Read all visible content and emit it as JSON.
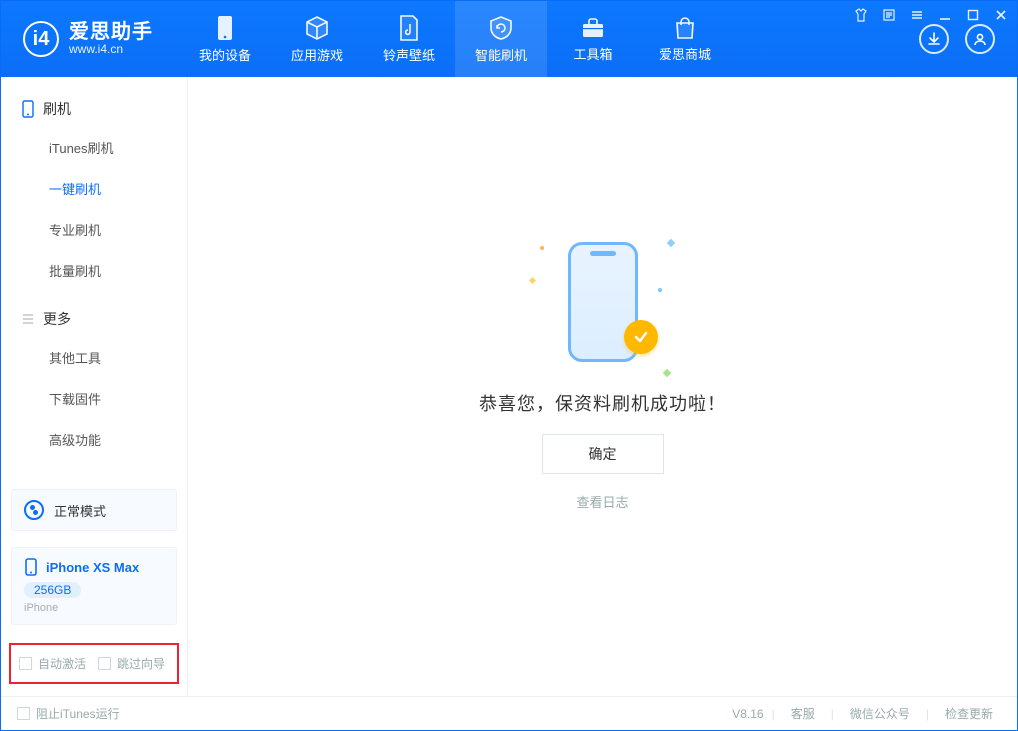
{
  "app": {
    "name_cn": "爱思助手",
    "name_en": "www.i4.cn"
  },
  "nav": {
    "items": [
      {
        "label": "我的设备"
      },
      {
        "label": "应用游戏"
      },
      {
        "label": "铃声壁纸"
      },
      {
        "label": "智能刷机"
      },
      {
        "label": "工具箱"
      },
      {
        "label": "爱思商城"
      }
    ],
    "active_index": 3
  },
  "sidebar": {
    "section1_title": "刷机",
    "section1_items": [
      {
        "label": "iTunes刷机"
      },
      {
        "label": "一键刷机"
      },
      {
        "label": "专业刷机"
      },
      {
        "label": "批量刷机"
      }
    ],
    "section1_active_index": 1,
    "section2_title": "更多",
    "section2_items": [
      {
        "label": "其他工具"
      },
      {
        "label": "下载固件"
      },
      {
        "label": "高级功能"
      }
    ],
    "mode_label": "正常模式",
    "device": {
      "name": "iPhone XS Max",
      "storage": "256GB",
      "sub": "iPhone"
    },
    "option_auto_activate": "自动激活",
    "option_skip_guide": "跳过向导"
  },
  "main": {
    "success_text": "恭喜您，保资料刷机成功啦！",
    "ok_button": "确定",
    "log_link": "查看日志"
  },
  "statusbar": {
    "block_itunes": "阻止iTunes运行",
    "version": "V8.16",
    "support": "客服",
    "wechat": "微信公众号",
    "check_update": "检查更新"
  }
}
